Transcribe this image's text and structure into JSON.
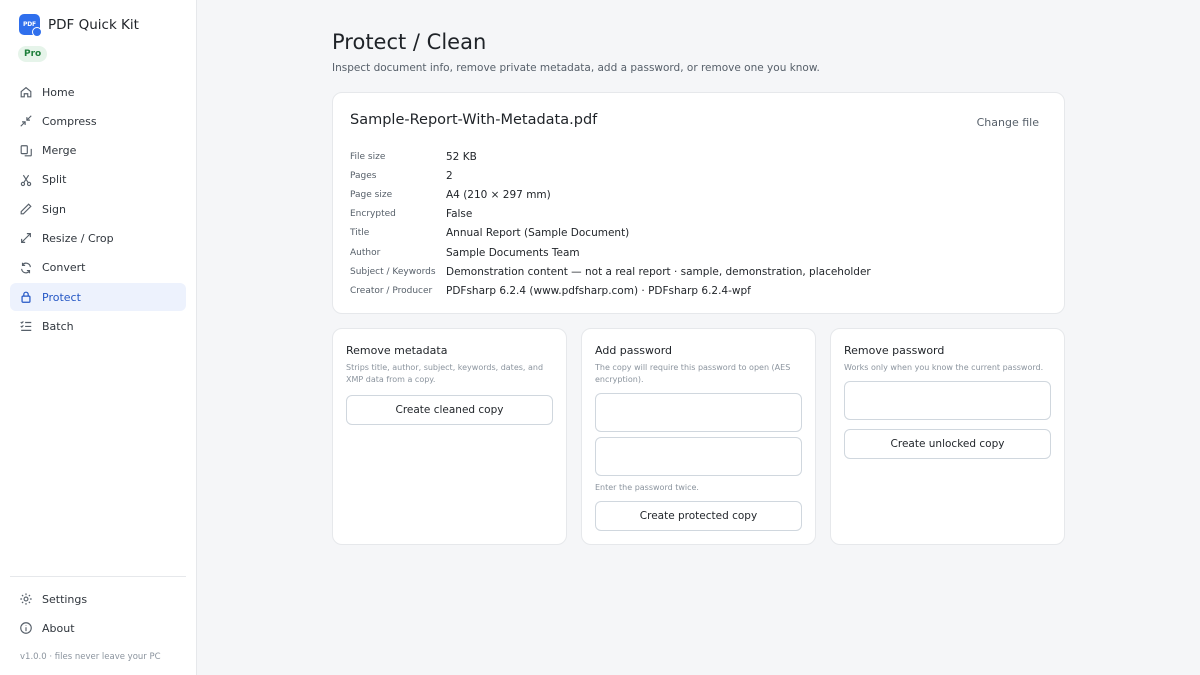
{
  "app": {
    "name": "PDF Quick Kit",
    "logo_text": "PDF",
    "badge": "Pro"
  },
  "sidebar": {
    "items": [
      {
        "label": "Home",
        "icon": "home-icon"
      },
      {
        "label": "Compress",
        "icon": "compress-icon"
      },
      {
        "label": "Merge",
        "icon": "merge-icon"
      },
      {
        "label": "Split",
        "icon": "split-icon"
      },
      {
        "label": "Sign",
        "icon": "pen-icon"
      },
      {
        "label": "Resize / Crop",
        "icon": "resize-icon"
      },
      {
        "label": "Convert",
        "icon": "convert-icon"
      },
      {
        "label": "Protect",
        "icon": "lock-icon",
        "active": true
      },
      {
        "label": "Batch",
        "icon": "batch-icon"
      }
    ],
    "bottom_items": [
      {
        "label": "Settings",
        "icon": "gear-icon"
      },
      {
        "label": "About",
        "icon": "info-icon"
      }
    ],
    "footer": "v1.0.0 · files never leave your PC"
  },
  "page": {
    "title": "Protect / Clean",
    "subtitle": "Inspect document info, remove private metadata, add a password, or remove one you know."
  },
  "file": {
    "name": "Sample-Report-With-Metadata.pdf",
    "change_label": "Change file",
    "info": [
      {
        "label": "File size",
        "value": "52 KB"
      },
      {
        "label": "Pages",
        "value": "2"
      },
      {
        "label": "Page size",
        "value": "A4 (210 × 297 mm)"
      },
      {
        "label": "Encrypted",
        "value": "False"
      },
      {
        "label": "Title",
        "value": "Annual Report (Sample Document)"
      },
      {
        "label": "Author",
        "value": "Sample Documents Team"
      },
      {
        "label": "Subject / Keywords",
        "value": "Demonstration content — not a real report  ·  sample, demonstration, placeholder"
      },
      {
        "label": "Creator / Producer",
        "value": "PDFsharp 6.2.4 (www.pdfsharp.com)  ·  PDFsharp 6.2.4-wpf"
      }
    ]
  },
  "remove_metadata": {
    "title": "Remove metadata",
    "description": "Strips title, author, subject, keywords, dates, and XMP data from a copy.",
    "button": "Create cleaned copy"
  },
  "add_password": {
    "title": "Add password",
    "description": "The copy will require this password to open (AES encryption).",
    "password_value": "",
    "confirm_value": "",
    "hint": "Enter the password twice.",
    "button": "Create protected copy"
  },
  "remove_password": {
    "title": "Remove password",
    "description": "Works only when you know the current password.",
    "password_value": "",
    "button": "Create unlocked copy"
  },
  "colors": {
    "accent": "#2f6fed",
    "active_bg": "#edf2fd",
    "active_text": "#2457c5",
    "badge_bg": "#e6f4ea",
    "badge_text": "#1e7f3b"
  }
}
